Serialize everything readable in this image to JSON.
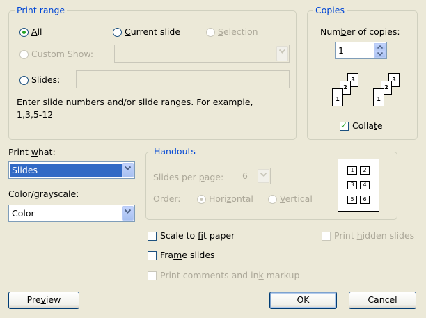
{
  "print_range": {
    "legend": "Print range",
    "all": {
      "before": "",
      "key": "A",
      "after": "ll"
    },
    "current_slide": {
      "before": "",
      "key": "C",
      "after": "urrent slide"
    },
    "selection": {
      "before": "",
      "key": "S",
      "after": "election"
    },
    "custom_show": {
      "before": "Cus",
      "key": "t",
      "after": "om Show:"
    },
    "custom_show_value": "",
    "slides": {
      "before": "Sl",
      "key": "i",
      "after": "des:"
    },
    "slides_value": "",
    "hint_line1": "Enter slide numbers and/or slide ranges. For example,",
    "hint_line2": "1,3,5-12"
  },
  "copies": {
    "legend": "Copies",
    "number_label": {
      "before": "Num",
      "key": "b",
      "after": "er of copies:"
    },
    "number_value": "1",
    "collate": {
      "before": "Colla",
      "key": "t",
      "after": "e"
    },
    "collate_checked": true,
    "collate_pages": [
      "1",
      "2",
      "3"
    ]
  },
  "print_what": {
    "label": {
      "before": "Print ",
      "key": "w",
      "after": "hat:"
    },
    "value": "Slides"
  },
  "color_grayscale": {
    "label": {
      "before": "Color/",
      "key": "g",
      "after": "rayscale:"
    },
    "value": "Color"
  },
  "handouts": {
    "legend": "Handouts",
    "slides_per_page": {
      "before": "Slides per ",
      "key": "p",
      "after": "age:"
    },
    "slides_per_page_value": "6",
    "order_label": "Order:",
    "horizontal": {
      "before": "Hori",
      "key": "z",
      "after": "ontal"
    },
    "vertical": {
      "before": "",
      "key": "V",
      "after": "ertical"
    },
    "layout_numbers": [
      "1",
      "2",
      "3",
      "4",
      "5",
      "6"
    ]
  },
  "options": {
    "scale_to_fit": {
      "before": "Scale to ",
      "key": "f",
      "after": "it paper"
    },
    "frame_slides": {
      "before": "Fra",
      "key": "m",
      "after": "e slides"
    },
    "print_comments": {
      "before": "Print comments and in",
      "key": "k",
      "after": " markup"
    },
    "print_hidden": {
      "before": "Print ",
      "key": "h",
      "after": "idden slides"
    }
  },
  "buttons": {
    "preview": {
      "before": "Pre",
      "key": "v",
      "after": "iew"
    },
    "ok": "OK",
    "cancel": "Cancel"
  },
  "colors": {
    "accent": "#0046D5",
    "dialog_bg": "#ECE9D8",
    "selection_bg": "#316AC5",
    "check_green": "#21A121"
  }
}
